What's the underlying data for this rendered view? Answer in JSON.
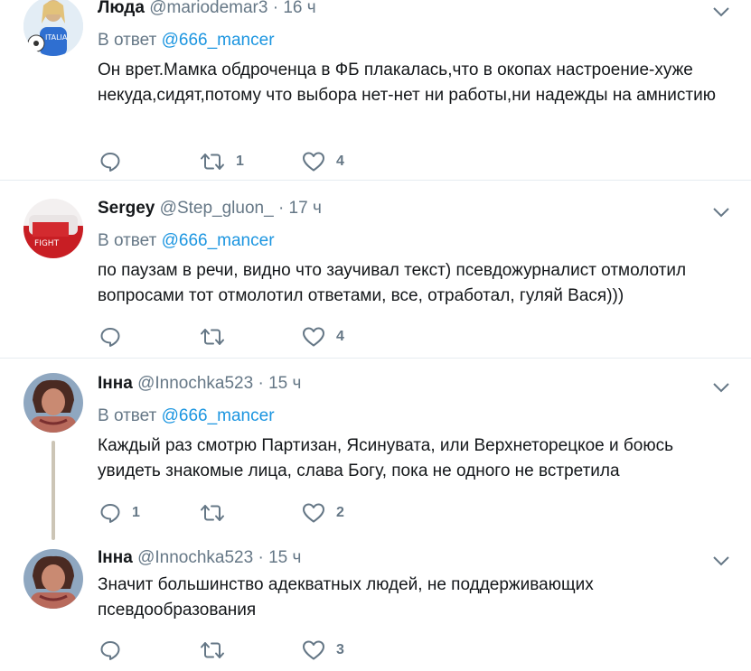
{
  "tweets": [
    {
      "name": "Люда",
      "handle": "@mariodemar3",
      "time": "16 ч",
      "reply_prefix": "В ответ",
      "reply_to": "@666_mancer",
      "text": "Он врет.Мамка обдроченца в ФБ плакалась,что в окопах настроение-хуже некуда,сидят,потому что выбора нет-нет ни работы,ни надежды на амнистию",
      "replies": "",
      "retweets": "1",
      "likes": "4"
    },
    {
      "name": "Sergey",
      "handle": "@Step_gluon_",
      "time": "17 ч",
      "reply_prefix": "В ответ",
      "reply_to": "@666_mancer",
      "text": "по паузам в речи, видно что заучивал текст) псевдожурналист отмолотил вопросами тот отмолотил ответами, все, отработал, гуляй Вася)))",
      "replies": "",
      "retweets": "",
      "likes": "4"
    },
    {
      "name": "Інна",
      "handle": "@Innochka523",
      "time": "15 ч",
      "reply_prefix": "В ответ",
      "reply_to": "@666_mancer",
      "text": "Каждый раз смотрю Партизан, Ясинувата, или Верхнеторецкое и боюсь увидеть знакомые лица, слава Богу, пока не одного не встретила",
      "replies": "1",
      "retweets": "",
      "likes": "2"
    },
    {
      "name": "Інна",
      "handle": "@Innochka523",
      "time": "15 ч",
      "text": "Значит большинство адекватных людей, не поддерживающих псевдообразования",
      "replies": "",
      "retweets": "",
      "likes": "3"
    }
  ],
  "colors": {
    "text": "#14171a",
    "secondary": "#657786",
    "link": "#1b95e0",
    "divider": "#e6ecf0",
    "thread_line": "#ccc5b6"
  }
}
